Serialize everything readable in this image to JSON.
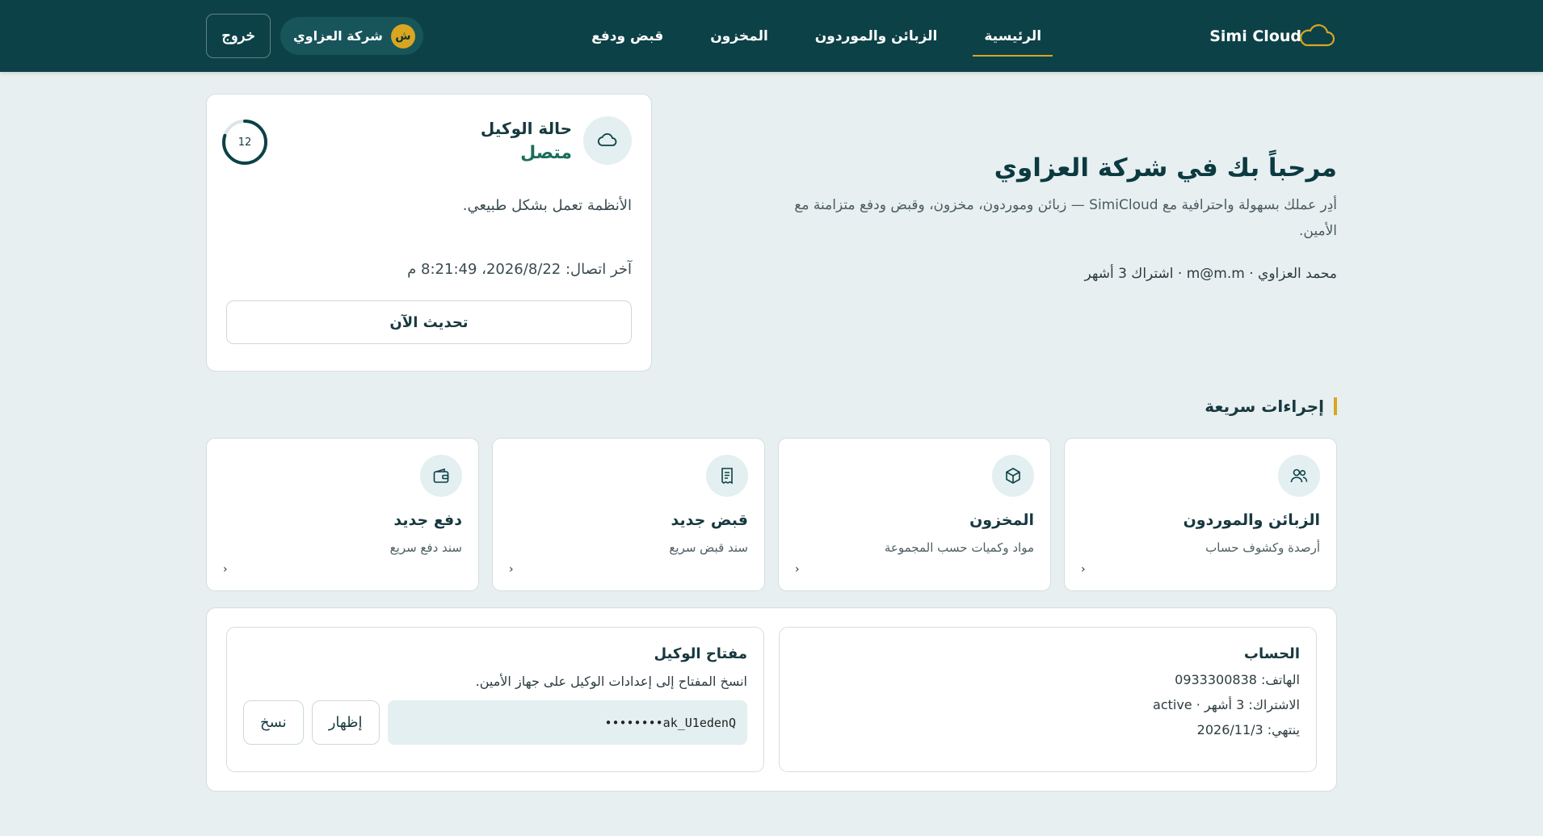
{
  "header": {
    "brand": "Simi Cloud",
    "nav": [
      {
        "label": "الرئيسية",
        "active": true
      },
      {
        "label": "الزبائن والموردون",
        "active": false
      },
      {
        "label": "المخزون",
        "active": false
      },
      {
        "label": "قبض ودفع",
        "active": false
      }
    ],
    "company_name": "شركة العزاوي",
    "avatar_letter": "ش",
    "logout_label": "خروج"
  },
  "welcome": {
    "title": "مرحباً بك في شركة العزاوي",
    "description": "أدِر عملك بسهولة واحترافية مع SimiCloud — زبائن وموردون، مخزون، وقبض ودفع متزامنة مع الأمين.",
    "meta": "محمد العزاوي · m@m.m · اشتراك 3 أشهر"
  },
  "agent_status": {
    "title": "حالة الوكيل",
    "value": "متصل",
    "countdown": "12",
    "countdown_fraction": 0.8,
    "message": "الأنظمة تعمل بشكل طبيعي.",
    "last_connection": "آخر اتصال: 2026/8/22، 8:21:49 م",
    "refresh_label": "تحديث الآن"
  },
  "quick_actions": {
    "title": "إجراءات سريعة",
    "items": [
      {
        "title": "الزبائن والموردون",
        "subtitle": "أرصدة وكشوف حساب",
        "icon": "users-icon"
      },
      {
        "title": "المخزون",
        "subtitle": "مواد وكميات حسب المجموعة",
        "icon": "box-icon"
      },
      {
        "title": "قبض جديد",
        "subtitle": "سند قبض سريع",
        "icon": "receipt-icon"
      },
      {
        "title": "دفع جديد",
        "subtitle": "سند دفع سريع",
        "icon": "wallet-icon"
      }
    ],
    "arrow": "‹"
  },
  "account": {
    "title": "الحساب",
    "phone": "الهاتف: 0933300838",
    "subscription": "الاشتراك: 3 أشهر · active",
    "expires": "ينتهي: 2026/11/3"
  },
  "agent_key": {
    "title": "مفتاح الوكيل",
    "hint": "انسخ المفتاح إلى إعدادات الوكيل على جهاز الأمين.",
    "masked_key": "••••••••ak_U1edenQ",
    "show_label": "إظهار",
    "copy_label": "نسخ"
  },
  "colors": {
    "header_bg": "#0c4147",
    "accent": "#d8a620",
    "status_connected": "#1b6f5c",
    "page_bg": "#e8eff0"
  }
}
